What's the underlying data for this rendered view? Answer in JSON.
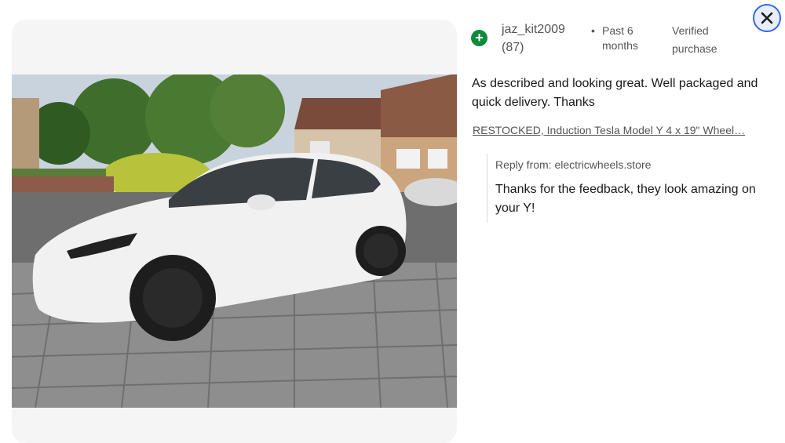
{
  "review": {
    "reviewer_name": "jaz_kit2009",
    "reviewer_score": "(87)",
    "time_dot": "•",
    "time_ago": "Past 6 months",
    "verified": "Verified purchase",
    "body": "As described and looking great. Well packaged and quick delivery. Thanks",
    "item_link": "RESTOCKED, Induction Tesla Model Y 4 x 19\" Wheel…",
    "reply_from": "Reply from: electricwheels.store",
    "reply_text": "Thanks for the feedback, they look amazing on your Y!"
  },
  "icons": {
    "reviewer_badge": "plus-circle-icon",
    "close": "close-icon"
  },
  "colors": {
    "badge_green": "#0f8a3a",
    "close_ring": "#3665f3",
    "text_secondary": "#555555",
    "text_primary": "#191919"
  }
}
